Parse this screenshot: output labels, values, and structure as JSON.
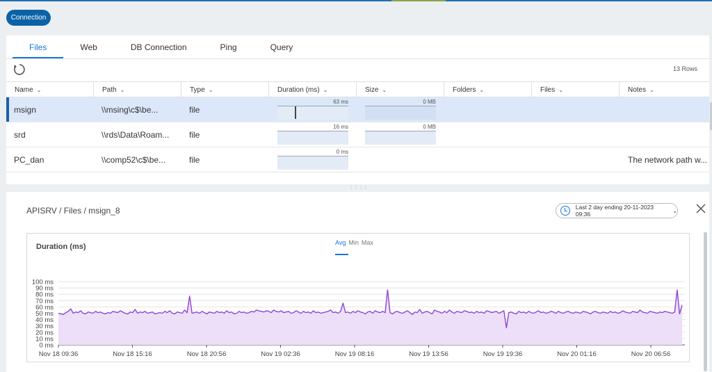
{
  "toolbar": {
    "connection_label": "Connection"
  },
  "tabs": [
    {
      "label": "Files",
      "active": true
    },
    {
      "label": "Web"
    },
    {
      "label": "DB Connection"
    },
    {
      "label": "Ping"
    },
    {
      "label": "Query"
    }
  ],
  "table": {
    "row_count": "13 Rows",
    "columns": [
      "Name",
      "Path",
      "Type",
      "Duration (ms)",
      "Size",
      "Folders",
      "Files",
      "Notes"
    ],
    "rows": [
      {
        "name": "msign",
        "path": "\\\\msing\\c$\\be...",
        "type": "file",
        "duration": "63 ms",
        "duration_fraction": 0.25,
        "size": "0 MB",
        "notes": "",
        "selected": true
      },
      {
        "name": "srd",
        "path": "\\\\rds\\Data\\Roam...",
        "type": "file",
        "duration": "16 ms",
        "duration_fraction": 0.06,
        "size": "0 MB",
        "notes": ""
      },
      {
        "name": "PC_dan",
        "path": "\\\\comp52\\c$\\be...",
        "type": "file",
        "duration": "0 ms",
        "duration_fraction": 0,
        "size": "",
        "notes": "The network path w..."
      }
    ]
  },
  "detail": {
    "breadcrumb": "APISRV / Files / msign_8",
    "date_range": "Last 2 day ending  20-11-2023 09:36",
    "chart_title": "Duration (ms)",
    "modes": [
      "Avg",
      "Min",
      "Max"
    ],
    "active_mode": "Avg"
  },
  "chart_data": {
    "type": "area",
    "title": "Duration (ms)",
    "series": [
      {
        "name": "Avg",
        "color": "#8e44d6",
        "fill": "#ecdff7"
      }
    ],
    "ylim": [
      0,
      100
    ],
    "yticks": [
      "0 ms",
      "10 ms",
      "20 ms",
      "30 ms",
      "40 ms",
      "50 ms",
      "60 ms",
      "70 ms",
      "80 ms",
      "90 ms",
      "100 ms"
    ],
    "xticks": [
      "Nov 18 09:36",
      "Nov 18 15:16",
      "Nov 18 20:56",
      "Nov 19 02:36",
      "Nov 19 08:16",
      "Nov 19 13:56",
      "Nov 19 19:36",
      "Nov 20 01:16",
      "Nov 20 06:56"
    ],
    "x_range_hours": [
      0,
      48
    ],
    "values": [
      50,
      49,
      48,
      51,
      53,
      57,
      50,
      52,
      51,
      54,
      50,
      49,
      52,
      51,
      50,
      53,
      51,
      52,
      50,
      49,
      51,
      50,
      53,
      52,
      51,
      54,
      52,
      50,
      49,
      52,
      51,
      56,
      50,
      52,
      51,
      53,
      50,
      51,
      52,
      49,
      50,
      51,
      50,
      53,
      51,
      54,
      50,
      49,
      52,
      51,
      50,
      55,
      51,
      77,
      50,
      51,
      52,
      50,
      53,
      51,
      49,
      52,
      51,
      50,
      53,
      51,
      52,
      50,
      54,
      51,
      52,
      49,
      50,
      53,
      51,
      52,
      50,
      51,
      53,
      52,
      55,
      54,
      53,
      52,
      54,
      53,
      51,
      55,
      53,
      52,
      54,
      51,
      52,
      53,
      50,
      51,
      54,
      52,
      50,
      53,
      51,
      52,
      50,
      54,
      51,
      52,
      50,
      51,
      52,
      53,
      55,
      51,
      52,
      50,
      53,
      66,
      51,
      52,
      50,
      53,
      51,
      54,
      52,
      51,
      49,
      52,
      53,
      50,
      54,
      52,
      51,
      53,
      51,
      87,
      51,
      49,
      52,
      53,
      51,
      50,
      52,
      54,
      51,
      48,
      52,
      51,
      56,
      50,
      52,
      53,
      51,
      49,
      55,
      53,
      52,
      50,
      53,
      51,
      55,
      52,
      50,
      53,
      52,
      51,
      54,
      53,
      51,
      52,
      50,
      53,
      51,
      52,
      50,
      54,
      53,
      51,
      52,
      53,
      50,
      52,
      54,
      27,
      51,
      52,
      50,
      49,
      53,
      51,
      52,
      50,
      53,
      51,
      50,
      52,
      54,
      51,
      52,
      50,
      51,
      53,
      52,
      50,
      53,
      51,
      50,
      52,
      53,
      51,
      50,
      52,
      51,
      50,
      53,
      52,
      51,
      49,
      52,
      53,
      51,
      50,
      52,
      51,
      50,
      53,
      51,
      52,
      50,
      51,
      54,
      52,
      51,
      50,
      53,
      52,
      51,
      55,
      52,
      51,
      50,
      53,
      52,
      51,
      50,
      52,
      51,
      53,
      52,
      51,
      50,
      52,
      87,
      49,
      63
    ]
  }
}
